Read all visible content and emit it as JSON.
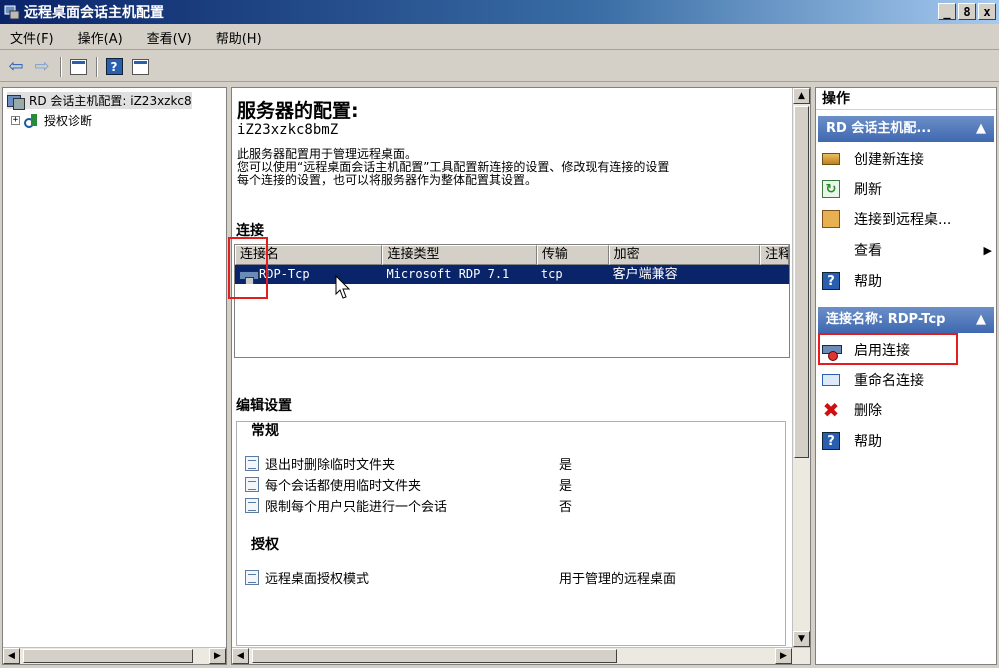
{
  "window": {
    "title": "远程桌面会话主机配置",
    "min": "_",
    "max": "8",
    "close": "x"
  },
  "menu": [
    "文件(F)",
    "操作(A)",
    "查看(V)",
    "帮助(H)"
  ],
  "tree": {
    "root_label": "RD 会话主机配置: iZ23xzkc8",
    "child_label": "授权诊断",
    "expander": "+"
  },
  "center": {
    "title": "服务器的配置:",
    "hostname": "iZ23xzkc8bmZ",
    "desc_lines": [
      "此服务器配置用于管理远程桌面。",
      "您可以使用“远程桌面会话主机配置”工具配置新连接的设置、修改现有连接的设置",
      "每个连接的设置，也可以将服务器作为整体配置其设置。"
    ],
    "connections_heading": "连接",
    "columns": [
      "连接名",
      "连接类型",
      "传输",
      "加密",
      "注释"
    ],
    "row": {
      "name": "RDP-Tcp",
      "type": "Microsoft RDP 7.1",
      "transport": "tcp",
      "encryption": "客户端兼容",
      "comment": ""
    },
    "edit_heading": "编辑设置",
    "general_heading": "常规",
    "general_rows": [
      {
        "label": "退出时删除临时文件夹",
        "value": "是"
      },
      {
        "label": "每个会话都使用临时文件夹",
        "value": "是"
      },
      {
        "label": "限制每个用户只能进行一个会话",
        "value": "否"
      }
    ],
    "license_heading": "授权",
    "license_rows": [
      {
        "label": "远程桌面授权模式",
        "value": "用于管理的远程桌面"
      }
    ]
  },
  "actions": {
    "top": "操作",
    "group1": "RD 会话主机配...",
    "group1_items": [
      "创建新连接",
      "刷新",
      "连接到远程桌...",
      "查看",
      "帮助"
    ],
    "group2": "连接名称: RDP-Tcp",
    "group2_items": [
      "启用连接",
      "重命名连接",
      "删除",
      "帮助"
    ],
    "collapse": "▲",
    "submenu_arrow": "▶"
  },
  "colors": {
    "highlight": "#e21d1d",
    "selection": "#0a246a",
    "action_header": "#3f68b0"
  }
}
